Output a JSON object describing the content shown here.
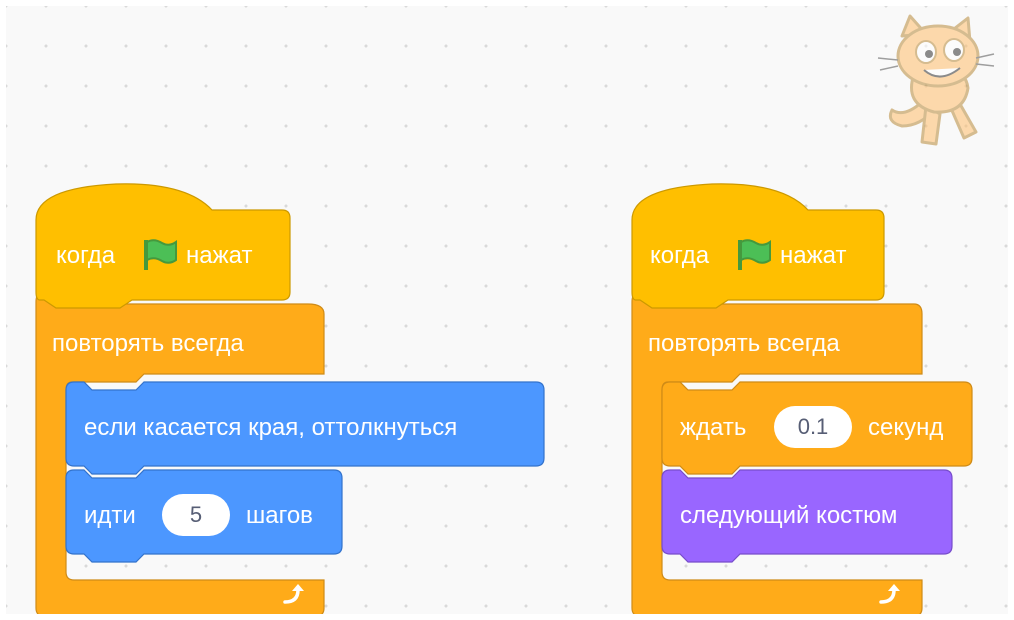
{
  "colors": {
    "events": "#ffbf00",
    "control": "#ffab19",
    "motion": "#4c97ff",
    "looks": "#9966ff",
    "flag_green": "#4cbf56",
    "text": "#ffffff",
    "pill_text": "#575e75"
  },
  "sprite": {
    "icon": "cat-sprite-icon"
  },
  "scripts": [
    {
      "hat": {
        "before": "когда",
        "icon": "green-flag-icon",
        "after": "нажат"
      },
      "loop": {
        "label": "повторять всегда",
        "end_icon": "loop-arrow-icon"
      },
      "inner": [
        {
          "text": "если касается края, оттолкнуться"
        },
        {
          "before": "идти",
          "value": "5",
          "after": "шагов"
        }
      ]
    },
    {
      "hat": {
        "before": "когда",
        "icon": "green-flag-icon",
        "after": "нажат"
      },
      "loop": {
        "label": "повторять всегда",
        "end_icon": "loop-arrow-icon"
      },
      "inner": [
        {
          "before": "ждать",
          "value": "0.1",
          "after": "секунд"
        },
        {
          "text": "следующий костюм"
        }
      ]
    }
  ]
}
